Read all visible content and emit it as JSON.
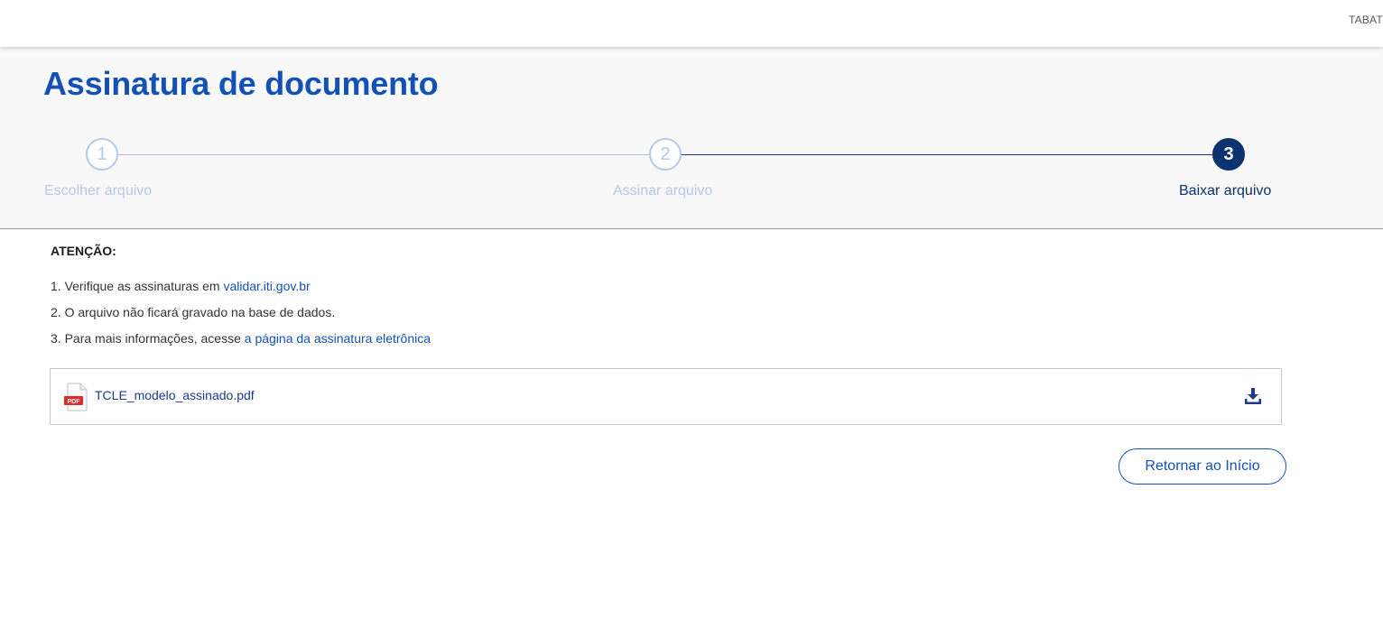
{
  "topbar": {
    "user_text": "TABAT"
  },
  "page": {
    "title": "Assinatura de documento"
  },
  "steps": [
    {
      "number": "1",
      "label": "Escolher arquivo",
      "state": "inactive"
    },
    {
      "number": "2",
      "label": "Assinar arquivo",
      "state": "inactive"
    },
    {
      "number": "3",
      "label": "Baixar arquivo",
      "state": "active"
    }
  ],
  "notice": {
    "heading": "ATENÇÃO:",
    "items": [
      {
        "prefix": "1. Verifique as assinaturas em ",
        "link": "validar.iti.gov.br"
      },
      {
        "prefix": "2. O arquivo não ficará gravado na base de dados.",
        "link": ""
      },
      {
        "prefix": "3. Para mais informações, acesse ",
        "link": "a página da assinatura eletrônica"
      }
    ]
  },
  "file": {
    "icon": "pdf-file-icon",
    "icon_label": "PDF",
    "name": "TCLE_modelo_assinado.pdf",
    "action_icon": "download-icon"
  },
  "actions": {
    "return_label": "Retornar ao Início"
  },
  "colors": {
    "primary": "#1351b4",
    "active_step": "#0c326f",
    "inactive_step": "#b6c8e6",
    "pdf_red": "#e02a2a"
  }
}
